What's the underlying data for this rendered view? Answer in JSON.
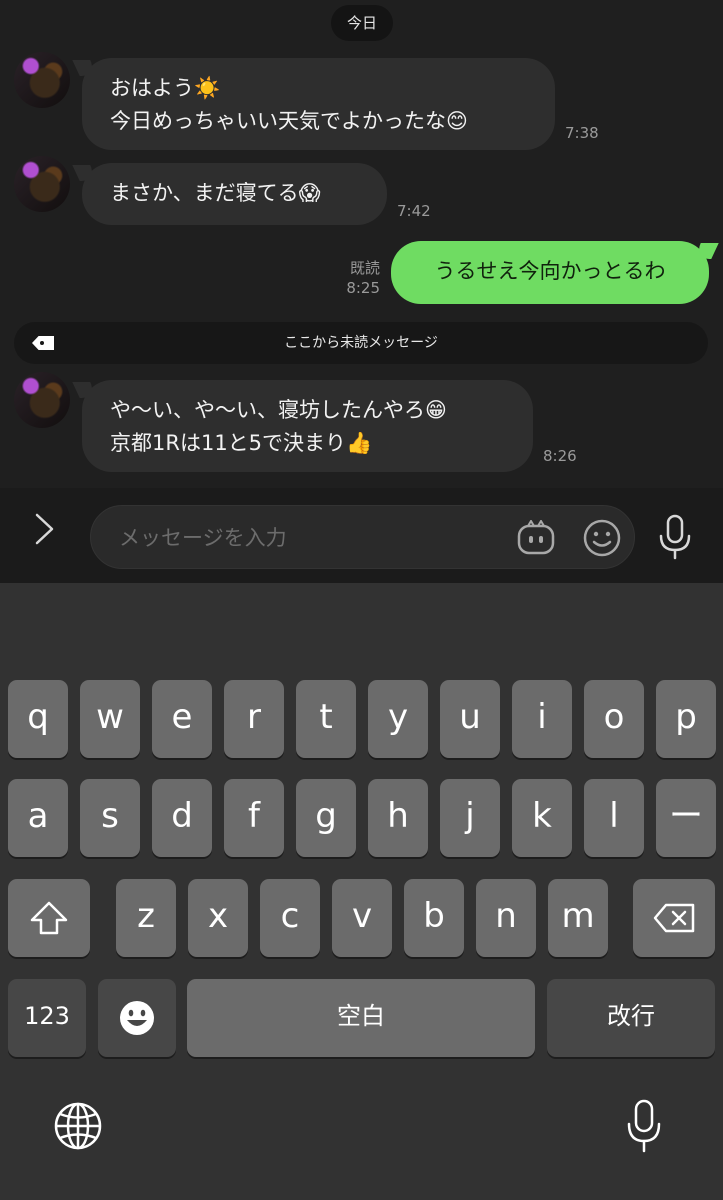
{
  "chat": {
    "date_label": "今日",
    "messages": [
      {
        "lines": [
          "おはよう☀️",
          "今日めっちゃいい天気でよかったな😊"
        ],
        "time": "7:38"
      },
      {
        "lines": [
          "まさか、まだ寝てる😱"
        ],
        "time": "7:42"
      },
      {
        "text": "うるせえ今向かっとるわ",
        "read_label": "既読",
        "time": "8:25"
      },
      {
        "lines": [
          "や〜い、や〜い、寝坊したんやろ😁",
          "京都1Rは11と5で決まり👍"
        ],
        "time": "8:26"
      }
    ],
    "unread_label": "ここから未読メッセージ"
  },
  "input": {
    "placeholder": "メッセージを入力",
    "value": ""
  },
  "keyboard": {
    "row1": [
      "q",
      "w",
      "e",
      "r",
      "t",
      "y",
      "u",
      "i",
      "o",
      "p"
    ],
    "row2": [
      "a",
      "s",
      "d",
      "f",
      "g",
      "h",
      "j",
      "k",
      "l",
      "ー"
    ],
    "row3": [
      "z",
      "x",
      "c",
      "v",
      "b",
      "n",
      "m"
    ],
    "numbers_label": "123",
    "space_label": "空白",
    "return_label": "改行"
  },
  "icons": {
    "expand": "chevron-right-icon",
    "sticker": "sticker-icon",
    "emoji": "emoji-icon",
    "voice": "microphone-icon",
    "shift": "shift-icon",
    "delete": "backspace-icon",
    "globe": "globe-icon",
    "tag": "tag-icon"
  },
  "colors": {
    "background": "#1f1f1f",
    "incoming_bubble": "#2e2e2e",
    "outgoing_bubble": "#6fdc62",
    "key": "#6b6b6b",
    "key_dark": "#474747"
  }
}
